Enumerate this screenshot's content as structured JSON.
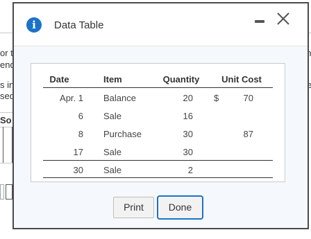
{
  "background": {
    "left_fragments": [
      "or th",
      "end",
      "s in",
      "sed",
      "So"
    ],
    "right_fragments": [
      "ent",
      "r e"
    ]
  },
  "dialog": {
    "title": "Data Table",
    "icons": {
      "info": "info-icon",
      "minimize": "minimize-icon",
      "close": "close-icon"
    }
  },
  "table": {
    "headers": {
      "date": "Date",
      "item": "Item",
      "quantity": "Quantity",
      "unit_cost": "Unit Cost"
    },
    "currency_symbol": "$",
    "rows": [
      {
        "date": "Apr. 1",
        "item": "Balance",
        "quantity": "20",
        "unit_cost": "70"
      },
      {
        "date": "6",
        "item": "Sale",
        "quantity": "16",
        "unit_cost": ""
      },
      {
        "date": "8",
        "item": "Purchase",
        "quantity": "30",
        "unit_cost": "87"
      },
      {
        "date": "17",
        "item": "Sale",
        "quantity": "30",
        "unit_cost": ""
      },
      {
        "date": "30",
        "item": "Sale",
        "quantity": "2",
        "unit_cost": ""
      }
    ]
  },
  "buttons": {
    "print": "Print",
    "done": "Done"
  },
  "colors": {
    "accent": "#1a73c8",
    "body_bg": "#f5f8fc"
  }
}
